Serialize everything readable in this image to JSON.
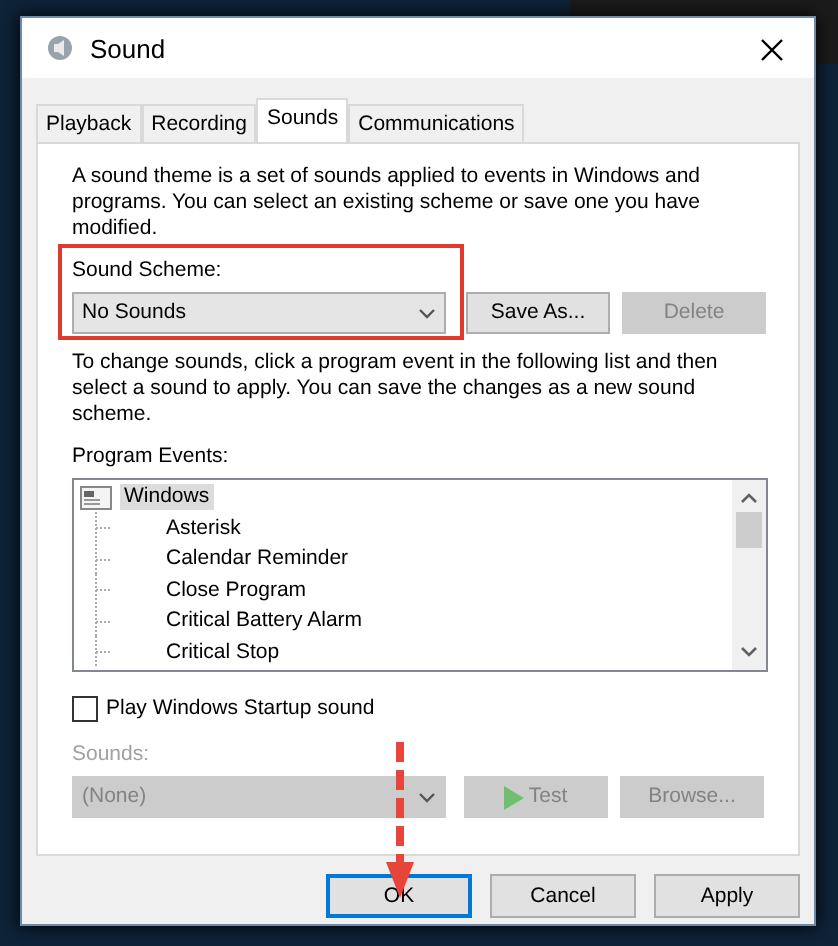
{
  "window": {
    "title": "Sound"
  },
  "tabs": [
    {
      "label": "Playback",
      "selected": false
    },
    {
      "label": "Recording",
      "selected": false
    },
    {
      "label": "Sounds",
      "selected": true
    },
    {
      "label": "Communications",
      "selected": false
    }
  ],
  "description": "A sound theme is a set of sounds applied to events in Windows and programs.  You can select an existing scheme or save one you have modified.",
  "scheme": {
    "label": "Sound Scheme:",
    "value": "No Sounds",
    "highlighted": true
  },
  "scheme_buttons": [
    {
      "label": "Save As...",
      "disabled": false
    },
    {
      "label": "Delete",
      "disabled": true
    }
  ],
  "instructions": "To change sounds, click a program event in the following list and then select a sound to apply.  You can save the changes as a new sound scheme.",
  "events": {
    "label": "Program Events:",
    "items": [
      {
        "label": "Windows",
        "selected": true,
        "children": [
          {
            "label": "Asterisk",
            "selected": false
          },
          {
            "label": "Calendar Reminder",
            "selected": false
          },
          {
            "label": "Close Program",
            "selected": false
          },
          {
            "label": "Critical Battery Alarm",
            "selected": false
          },
          {
            "label": "Critical Stop",
            "selected": false
          }
        ]
      }
    ]
  },
  "startup_sound": {
    "label": "Play Windows Startup sound",
    "checked": false
  },
  "sounds": {
    "label": "Sounds:",
    "value": "(None)",
    "disabled": true
  },
  "sound_buttons": [
    {
      "kind": "play",
      "label": "Test",
      "disabled": true
    },
    {
      "kind": "plain",
      "label": "Browse...",
      "disabled": true
    }
  ],
  "footer_buttons": [
    {
      "label": "OK",
      "focused": true,
      "pointed_at": true
    },
    {
      "label": "Cancel",
      "focused": false,
      "pointed_at": false
    },
    {
      "label": "Apply",
      "focused": false,
      "pointed_at": false
    }
  ]
}
